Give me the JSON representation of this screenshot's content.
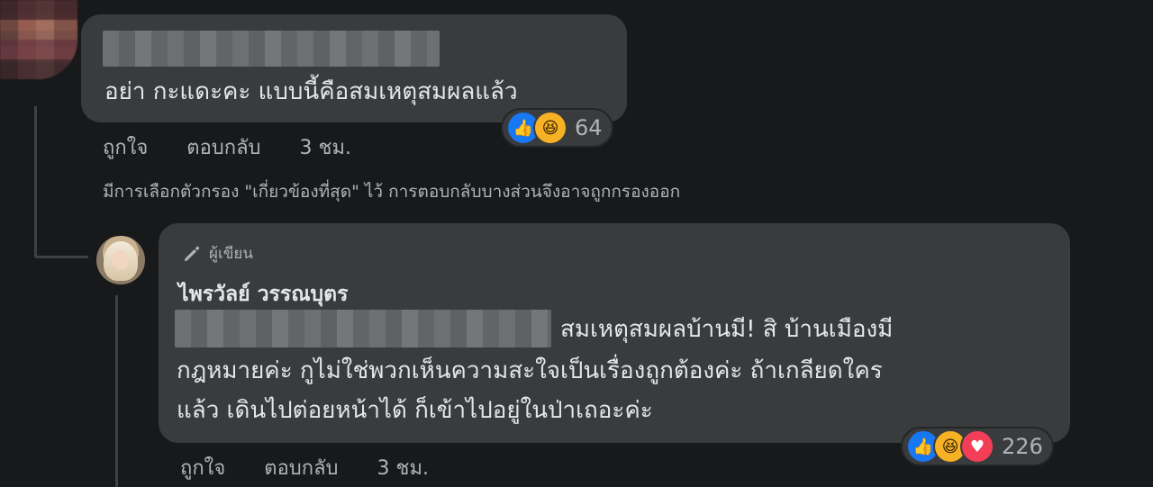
{
  "comment1": {
    "body": "อย่า กะแดะคะ แบบนี้คือสมเหตุสมผลแล้ว",
    "reactions": {
      "icons": [
        "like-icon",
        "haha-icon"
      ],
      "count": "64"
    },
    "actions": {
      "like": "ถูกใจ",
      "reply": "ตอบกลับ",
      "time": "3 ชม."
    }
  },
  "filter_note": "มีการเลือกตัวกรอง \"เกี่ยวข้องที่สุด\" ไว้ การตอบกลับบางส่วนจึงอาจถูกกรองออก",
  "reply": {
    "badge": "ผู้เขียน",
    "author": "ไพรวัลย์ วรรณบุตร",
    "lines": [
      "สมเหตุสมผลบ้านมี! สิ บ้านเมืองมี",
      "กฎหมายค่ะ กูไม่ใช่พวกเห็นความสะใจเป็นเรื่องถูกต้องค่ะ ถ้าเกลียดใคร",
      "แล้ว เดินไปต่อยหน้าได้ ก็เข้าไปอยู่ในป่าเถอะค่ะ"
    ],
    "reactions": {
      "icons": [
        "like-icon",
        "haha-icon",
        "love-icon"
      ],
      "count": "226"
    },
    "actions": {
      "like": "ถูกใจ",
      "reply": "ตอบกลับ",
      "time": "3 ชม."
    }
  },
  "colors": {
    "background": "#18191a",
    "bubble": "#3a3b3c",
    "text": "#e4e6eb",
    "secondary_text": "#b0b3b8",
    "like": "#1877f2",
    "haha": "#f7b125",
    "love": "#f33e58"
  }
}
